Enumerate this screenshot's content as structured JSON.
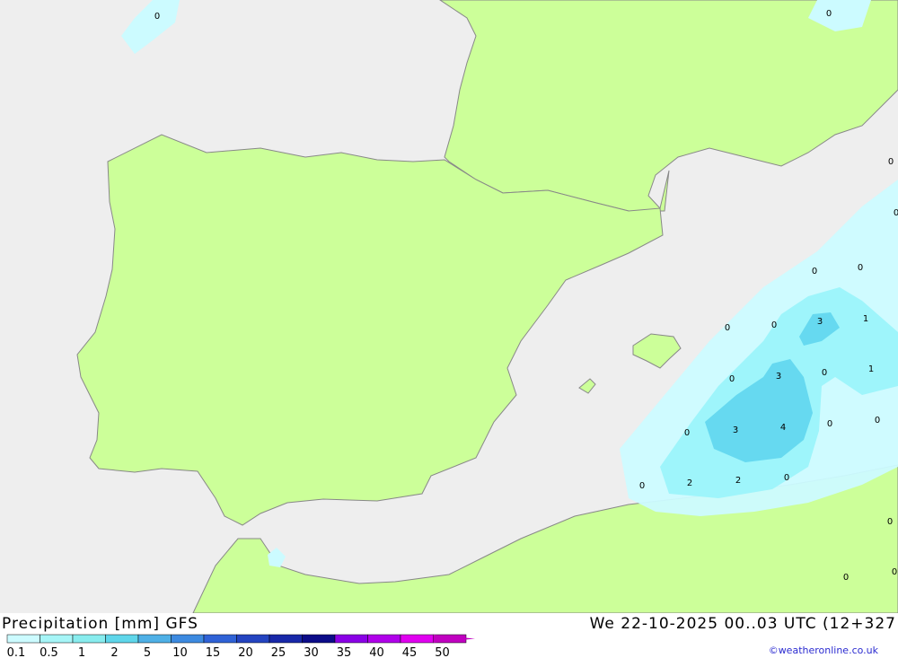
{
  "map": {
    "colors": {
      "sea": "#eeeeee",
      "land": "#ccff99",
      "border": "#888888",
      "precip_light": "#ccfbff",
      "precip_medium": "#9ef5fb",
      "precip_heavy": "#66d9f0"
    },
    "contour_labels": [
      {
        "name": "label-0-a",
        "text": "0"
      },
      {
        "name": "label-0-b",
        "text": "0"
      },
      {
        "name": "label-0-c",
        "text": "0"
      },
      {
        "name": "label-0-d",
        "text": "0"
      },
      {
        "name": "label-0-e",
        "text": "0"
      },
      {
        "name": "label-0-f",
        "text": "0"
      },
      {
        "name": "label-0-g",
        "text": "0"
      },
      {
        "name": "label-3-a",
        "text": "3"
      },
      {
        "name": "label-1-a",
        "text": "1"
      },
      {
        "name": "label-0-h",
        "text": "0"
      },
      {
        "name": "label-0-i",
        "text": "0"
      },
      {
        "name": "label-3-b",
        "text": "3"
      },
      {
        "name": "label-0-j",
        "text": "0"
      },
      {
        "name": "label-1-b",
        "text": "1"
      },
      {
        "name": "label-0-k",
        "text": "0"
      },
      {
        "name": "label-3-c",
        "text": "3"
      },
      {
        "name": "label-4-a",
        "text": "4"
      },
      {
        "name": "label-0-l",
        "text": "0"
      },
      {
        "name": "label-0-m",
        "text": "0"
      },
      {
        "name": "label-0-n",
        "text": "0"
      },
      {
        "name": "label-2-a",
        "text": "2"
      },
      {
        "name": "label-2-b",
        "text": "2"
      },
      {
        "name": "label-0-o",
        "text": "0"
      },
      {
        "name": "label-0-p",
        "text": "0"
      },
      {
        "name": "label-0-q",
        "text": "0"
      },
      {
        "name": "label-0-r",
        "text": "0"
      }
    ]
  },
  "footer": {
    "title": "Precipitation [mm] GFS",
    "datetime": "We 22-10-2025 00..03 UTC (12+327",
    "credit": "©weatheronline.co.uk"
  },
  "legend": {
    "ticks": [
      "0.1",
      "0.5",
      "1",
      "2",
      "5",
      "10",
      "15",
      "20",
      "25",
      "30",
      "35",
      "40",
      "45",
      "50"
    ],
    "colors": [
      "#ccfbff",
      "#a6f5f7",
      "#88ecee",
      "#5fd6ea",
      "#4fb0e6",
      "#3d8ae0",
      "#2f62d6",
      "#2444c0",
      "#1828a8",
      "#0c0c88",
      "#8a00e6",
      "#b000ea",
      "#e000f0",
      "#c000c0"
    ]
  }
}
